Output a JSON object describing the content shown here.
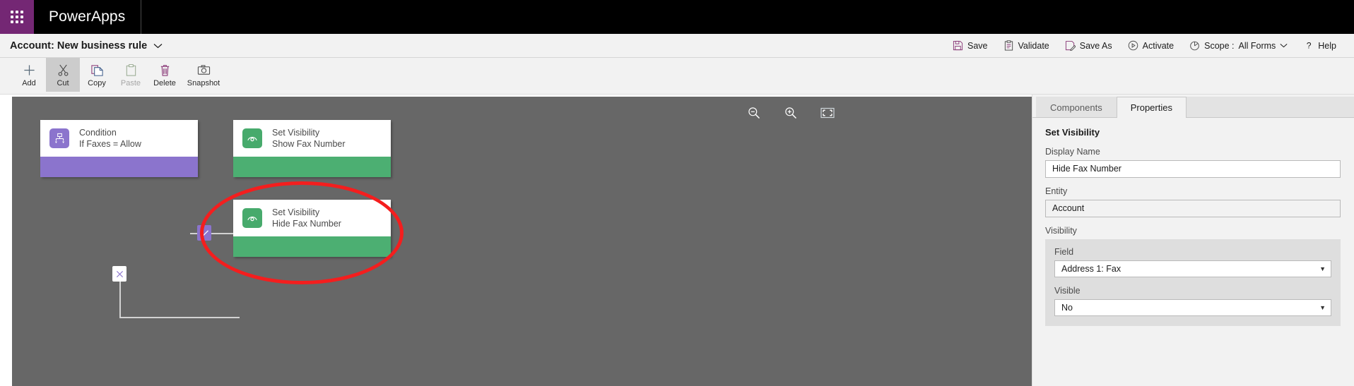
{
  "brand": {
    "waffle_icon": "app-launcher-icon",
    "name": "PowerApps"
  },
  "titlebar": {
    "title": "Account: New business rule",
    "chevron": "⌄",
    "actions": [
      {
        "label": "Save",
        "icon": "save-icon"
      },
      {
        "label": "Validate",
        "icon": "validate-icon"
      },
      {
        "label": "Save As",
        "icon": "save-as-icon"
      },
      {
        "label": "Activate",
        "icon": "activate-icon"
      },
      {
        "label": "Scope :",
        "icon": "scope-icon",
        "value": "All Forms",
        "chevron": "⌄"
      },
      {
        "label": "Help",
        "icon": "help-icon"
      }
    ]
  },
  "ribbon": {
    "tools": [
      {
        "label": "Add",
        "icon": "plus-icon",
        "state": "normal"
      },
      {
        "label": "Cut",
        "icon": "scissors-icon",
        "state": "selected"
      },
      {
        "label": "Copy",
        "icon": "copy-icon",
        "state": "normal"
      },
      {
        "label": "Paste",
        "icon": "paste-icon",
        "state": "disabled"
      },
      {
        "label": "Delete",
        "icon": "trash-icon",
        "state": "normal"
      },
      {
        "label": "Snapshot",
        "icon": "camera-icon",
        "state": "normal"
      }
    ]
  },
  "canvas": {
    "background_color": "#676767",
    "zoom_tools": [
      {
        "name": "zoom-out-icon",
        "title": "Zoom Out"
      },
      {
        "name": "zoom-in-icon",
        "title": "Zoom In"
      },
      {
        "name": "fit-to-screen-icon",
        "title": "Fit to Screen"
      }
    ],
    "nodes": [
      {
        "id": "condition",
        "type": "condition",
        "icon": "condition-branch-icon",
        "title": "Condition",
        "subtitle": "If Faxes = Allow",
        "accent": "#8b74cd"
      },
      {
        "id": "show-fax",
        "type": "action",
        "icon": "visibility-eye-icon",
        "title": "Set Visibility",
        "subtitle": "Show Fax Number",
        "accent": "#4caf72"
      },
      {
        "id": "hide-fax",
        "type": "action",
        "icon": "visibility-eye-icon",
        "title": "Set Visibility",
        "subtitle": "Hide Fax Number",
        "accent": "#4caf72"
      }
    ],
    "branches": [
      {
        "id": "yes-branch",
        "icon": "check-icon",
        "glyph": "✓"
      },
      {
        "id": "no-branch",
        "icon": "close-icon",
        "glyph": "✕"
      }
    ],
    "annotation": {
      "shape": "ellipse",
      "color": "#f41e1e",
      "target": "hide-fax"
    }
  },
  "panel": {
    "tabs": [
      {
        "label": "Components",
        "active": false
      },
      {
        "label": "Properties",
        "active": true
      }
    ],
    "heading": "Set Visibility",
    "fields": {
      "display_name_label": "Display Name",
      "display_name_value": "Hide Fax Number",
      "entity_label": "Entity",
      "entity_value": "Account",
      "visibility_label": "Visibility",
      "field_label": "Field",
      "field_value": "Address 1: Fax",
      "visible_label": "Visible",
      "visible_value": "No",
      "caret": "▼"
    }
  }
}
